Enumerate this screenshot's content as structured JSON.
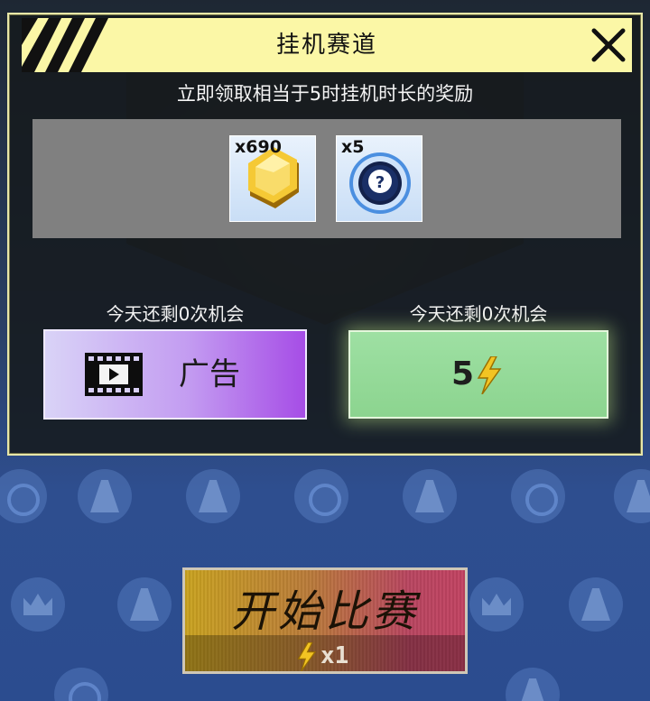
{
  "dialog": {
    "title": "挂机赛道",
    "subtitle": "立即领取相当于5时挂机时长的奖励",
    "rewards": [
      {
        "icon": "gold-hexagon-coin-icon",
        "quantity": "x690"
      },
      {
        "icon": "mystery-question-token-icon",
        "quantity": "x5"
      }
    ],
    "ad_option": {
      "chance_text": "今天还剩0次机会",
      "label": "广告",
      "icon": "film-play-icon"
    },
    "energy_option": {
      "chance_text": "今天还剩0次机会",
      "cost": "5",
      "icon": "lightning-bolt-icon"
    }
  },
  "start_race": {
    "label": "开始比赛",
    "cost": "x1",
    "icon": "lightning-bolt-icon"
  },
  "colors": {
    "title_bar": "#fbf7a6",
    "ad_button_end": "#a64de6",
    "energy_button": "#8cd48f",
    "dialog_border": "#e8e7a8"
  }
}
